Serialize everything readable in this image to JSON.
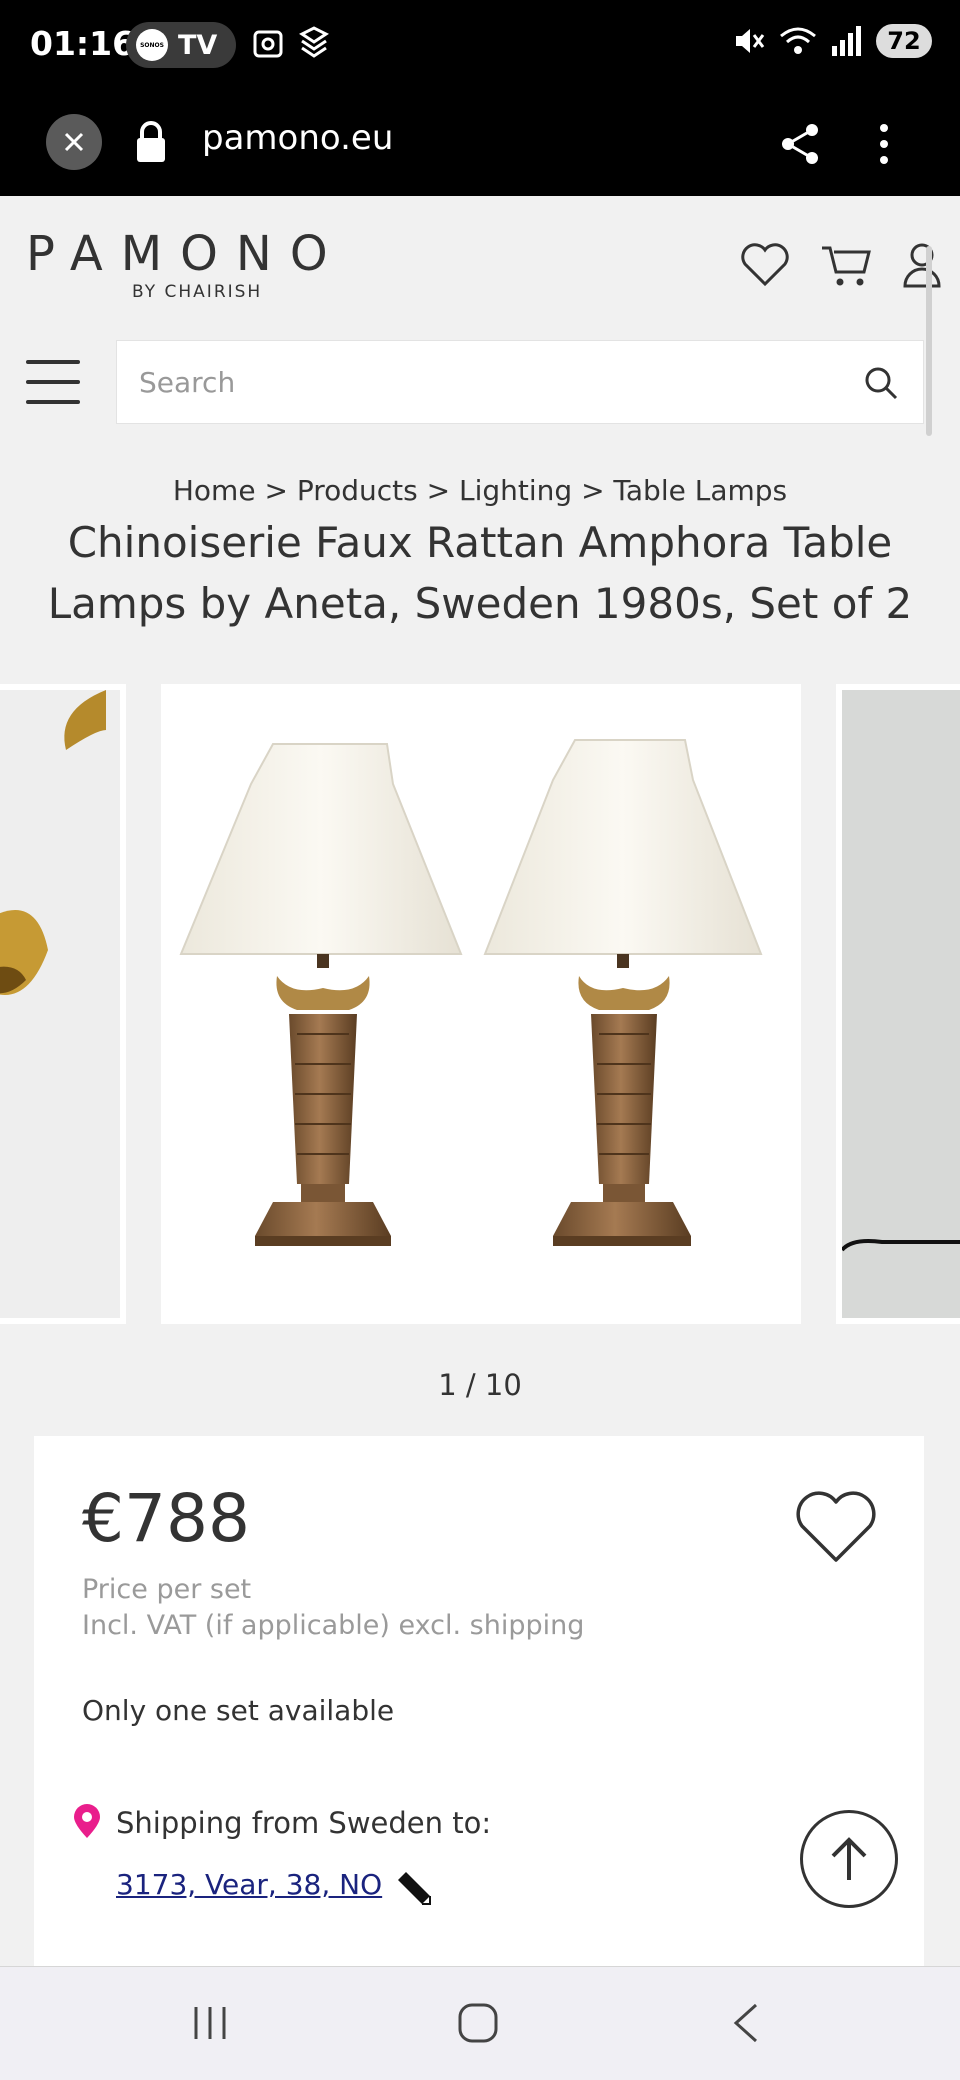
{
  "status_bar": {
    "time": "01:16",
    "media_app": "SONOS",
    "media_label": "TV",
    "battery": "72"
  },
  "browser": {
    "url": "pamono.eu"
  },
  "site": {
    "logo_text": "PAMONO",
    "logo_sub": "BY CHAIRISH"
  },
  "search": {
    "placeholder": "Search"
  },
  "breadcrumb": "Home > Products > Lighting > Table Lamps",
  "product": {
    "title": "Chinoiserie Faux Rattan Amphora Table Lamps by Aneta, Sweden 1980s, Set of 2",
    "image_counter": "1 / 10",
    "price": "€788",
    "price_unit": "Price per set",
    "vat_note": "Incl. VAT (if applicable) excl. shipping",
    "availability": "Only one set available",
    "shipping_label": "Shipping from Sweden to:",
    "shipping_address": "3173, Vear, 38, NO"
  },
  "colors": {
    "accent_pin": "#e91e8c",
    "link": "#1a237e",
    "background": "#f1f1f1"
  },
  "icons": [
    "close-icon",
    "lock-icon",
    "share-icon",
    "more-icon",
    "heart-icon",
    "cart-icon",
    "user-icon",
    "menu-icon",
    "search-icon",
    "location-pin-icon",
    "pencil-icon",
    "arrow-up-icon",
    "recent-apps-icon",
    "home-icon",
    "back-icon"
  ]
}
